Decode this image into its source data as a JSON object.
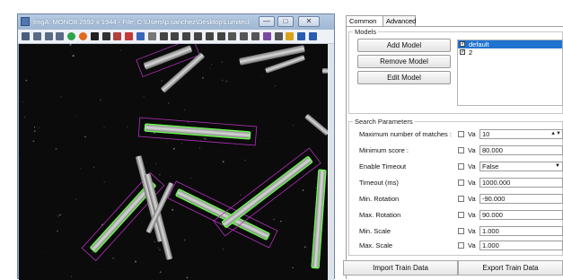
{
  "image_window": {
    "title": "ImgA: MONO8 2592 x 1944 - File: C:\\Users\\p.sanchez\\Desktop\\Lumitech...",
    "min_glyph": "—",
    "max_glyph": "□",
    "close_glyph": "✕",
    "toolbar_icons": [
      "fit-icon",
      "zoom-icon",
      "zoom-in-icon",
      "zoom-out-icon",
      "green-circle-icon",
      "orange-circle-icon",
      "pointer-icon",
      "rect-icon",
      "region-icon",
      "image-red-icon",
      "image-blue-icon",
      "image-gray-icon",
      "image-dark-icon",
      "plus-icon",
      "line-icon",
      "polyline-icon",
      "arc-icon",
      "circle-icon",
      "grid-icon",
      "star-icon",
      "star2-icon",
      "palette-icon",
      "gear-icon",
      "folder-icon",
      "save-icon",
      "save-as-icon"
    ]
  },
  "tabs": [
    {
      "label": "Common"
    },
    {
      "label": "Advanced"
    }
  ],
  "models": {
    "legend": "Models",
    "add_label": "Add Model",
    "remove_label": "Remove Model",
    "edit_label": "Edit Model",
    "list": [
      {
        "name": "default",
        "checked": true,
        "selected": true
      },
      {
        "name": "2",
        "checked": true,
        "selected": false
      }
    ]
  },
  "search": {
    "legend": "Search Parameters",
    "va_label": "Va",
    "rows": [
      {
        "label": "Maximum number of matches :",
        "value": "10",
        "control": "spin"
      },
      {
        "label": "Minimum score :",
        "value": "80.000",
        "control": "text"
      },
      {
        "label": "Enable Timeout",
        "value": "False",
        "control": "dropdown"
      },
      {
        "label": "Timeout (ms)",
        "value": "1000.000",
        "control": "text"
      },
      {
        "label": "Min. Rotation",
        "value": "-90.000",
        "control": "text"
      },
      {
        "label": "Max. Rotation",
        "value": "90.000",
        "control": "text"
      },
      {
        "label": "Min. Scale",
        "value": "1.000",
        "control": "text"
      },
      {
        "label": "Max. Scale",
        "value": "1.000",
        "control": "text"
      }
    ]
  },
  "buttons": {
    "import_label": "Import Train Data",
    "export_label": "Export Train Data"
  },
  "colors": {
    "match_outline": "#66ff4a",
    "search_box": "#b030b8",
    "selection": "#1f73d1"
  }
}
